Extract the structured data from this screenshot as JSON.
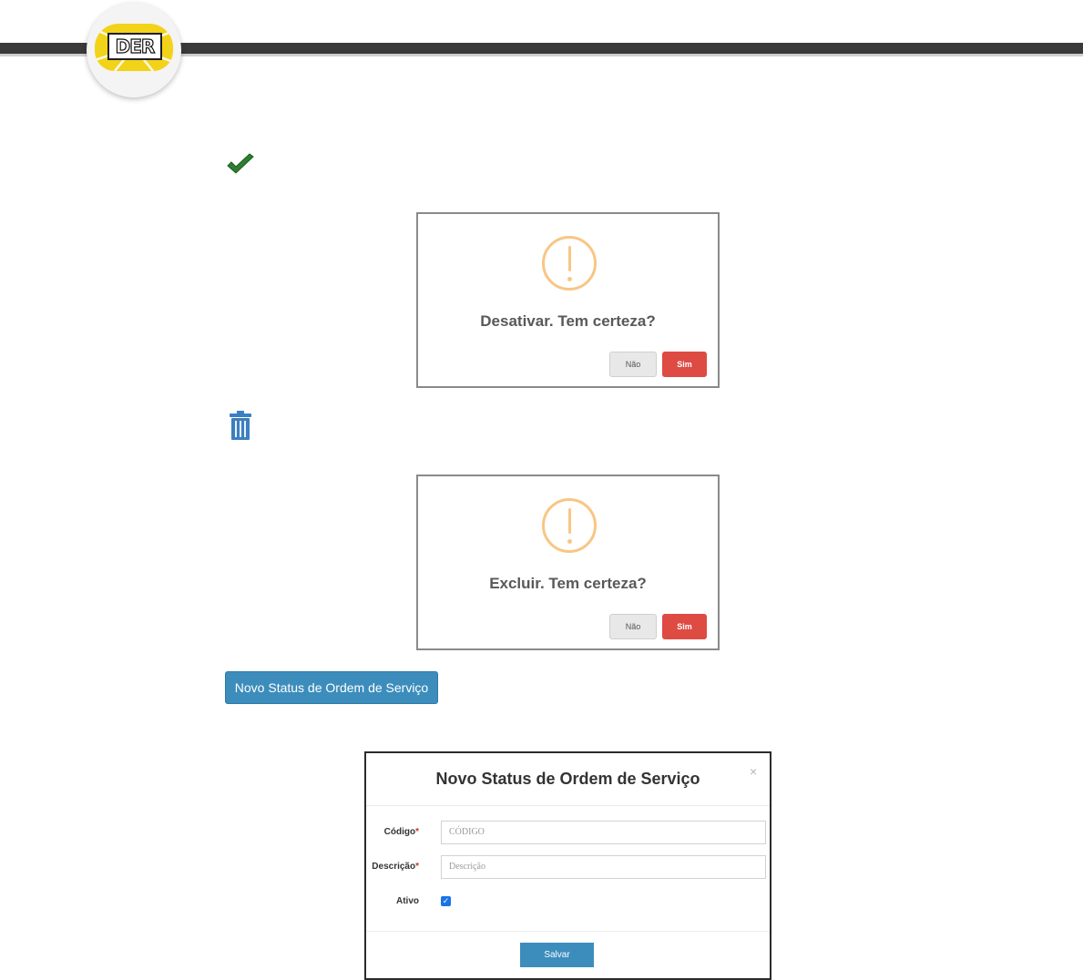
{
  "header": {
    "logo_text": "DER"
  },
  "dialogs": [
    {
      "title": "Desativar. Tem certeza?",
      "cancel_label": "Não",
      "confirm_label": "Sim"
    },
    {
      "title": "Excluir. Tem certeza?",
      "cancel_label": "Não",
      "confirm_label": "Sim"
    }
  ],
  "new_button_label": "Novo Status de Ordem de Serviço",
  "modal": {
    "title": "Novo Status de Ordem de Serviço",
    "close_label": "×",
    "codigo_label": "Código",
    "codigo_placeholder": "CÓDIGO",
    "descricao_label": "Descrição",
    "descricao_placeholder": "Descrição",
    "required_mark": "*",
    "ativo_label": "Ativo",
    "ativo_checked": true,
    "save_label": "Salvar"
  },
  "colors": {
    "header_bar": "#3a3a3a",
    "logo_yellow": "#f3d21a",
    "check_green": "#2e7d32",
    "trash_blue": "#3c7fc0",
    "warning_orange": "#f8c684",
    "danger_red": "#dd4b43",
    "primary_blue": "#3c8dbc"
  }
}
